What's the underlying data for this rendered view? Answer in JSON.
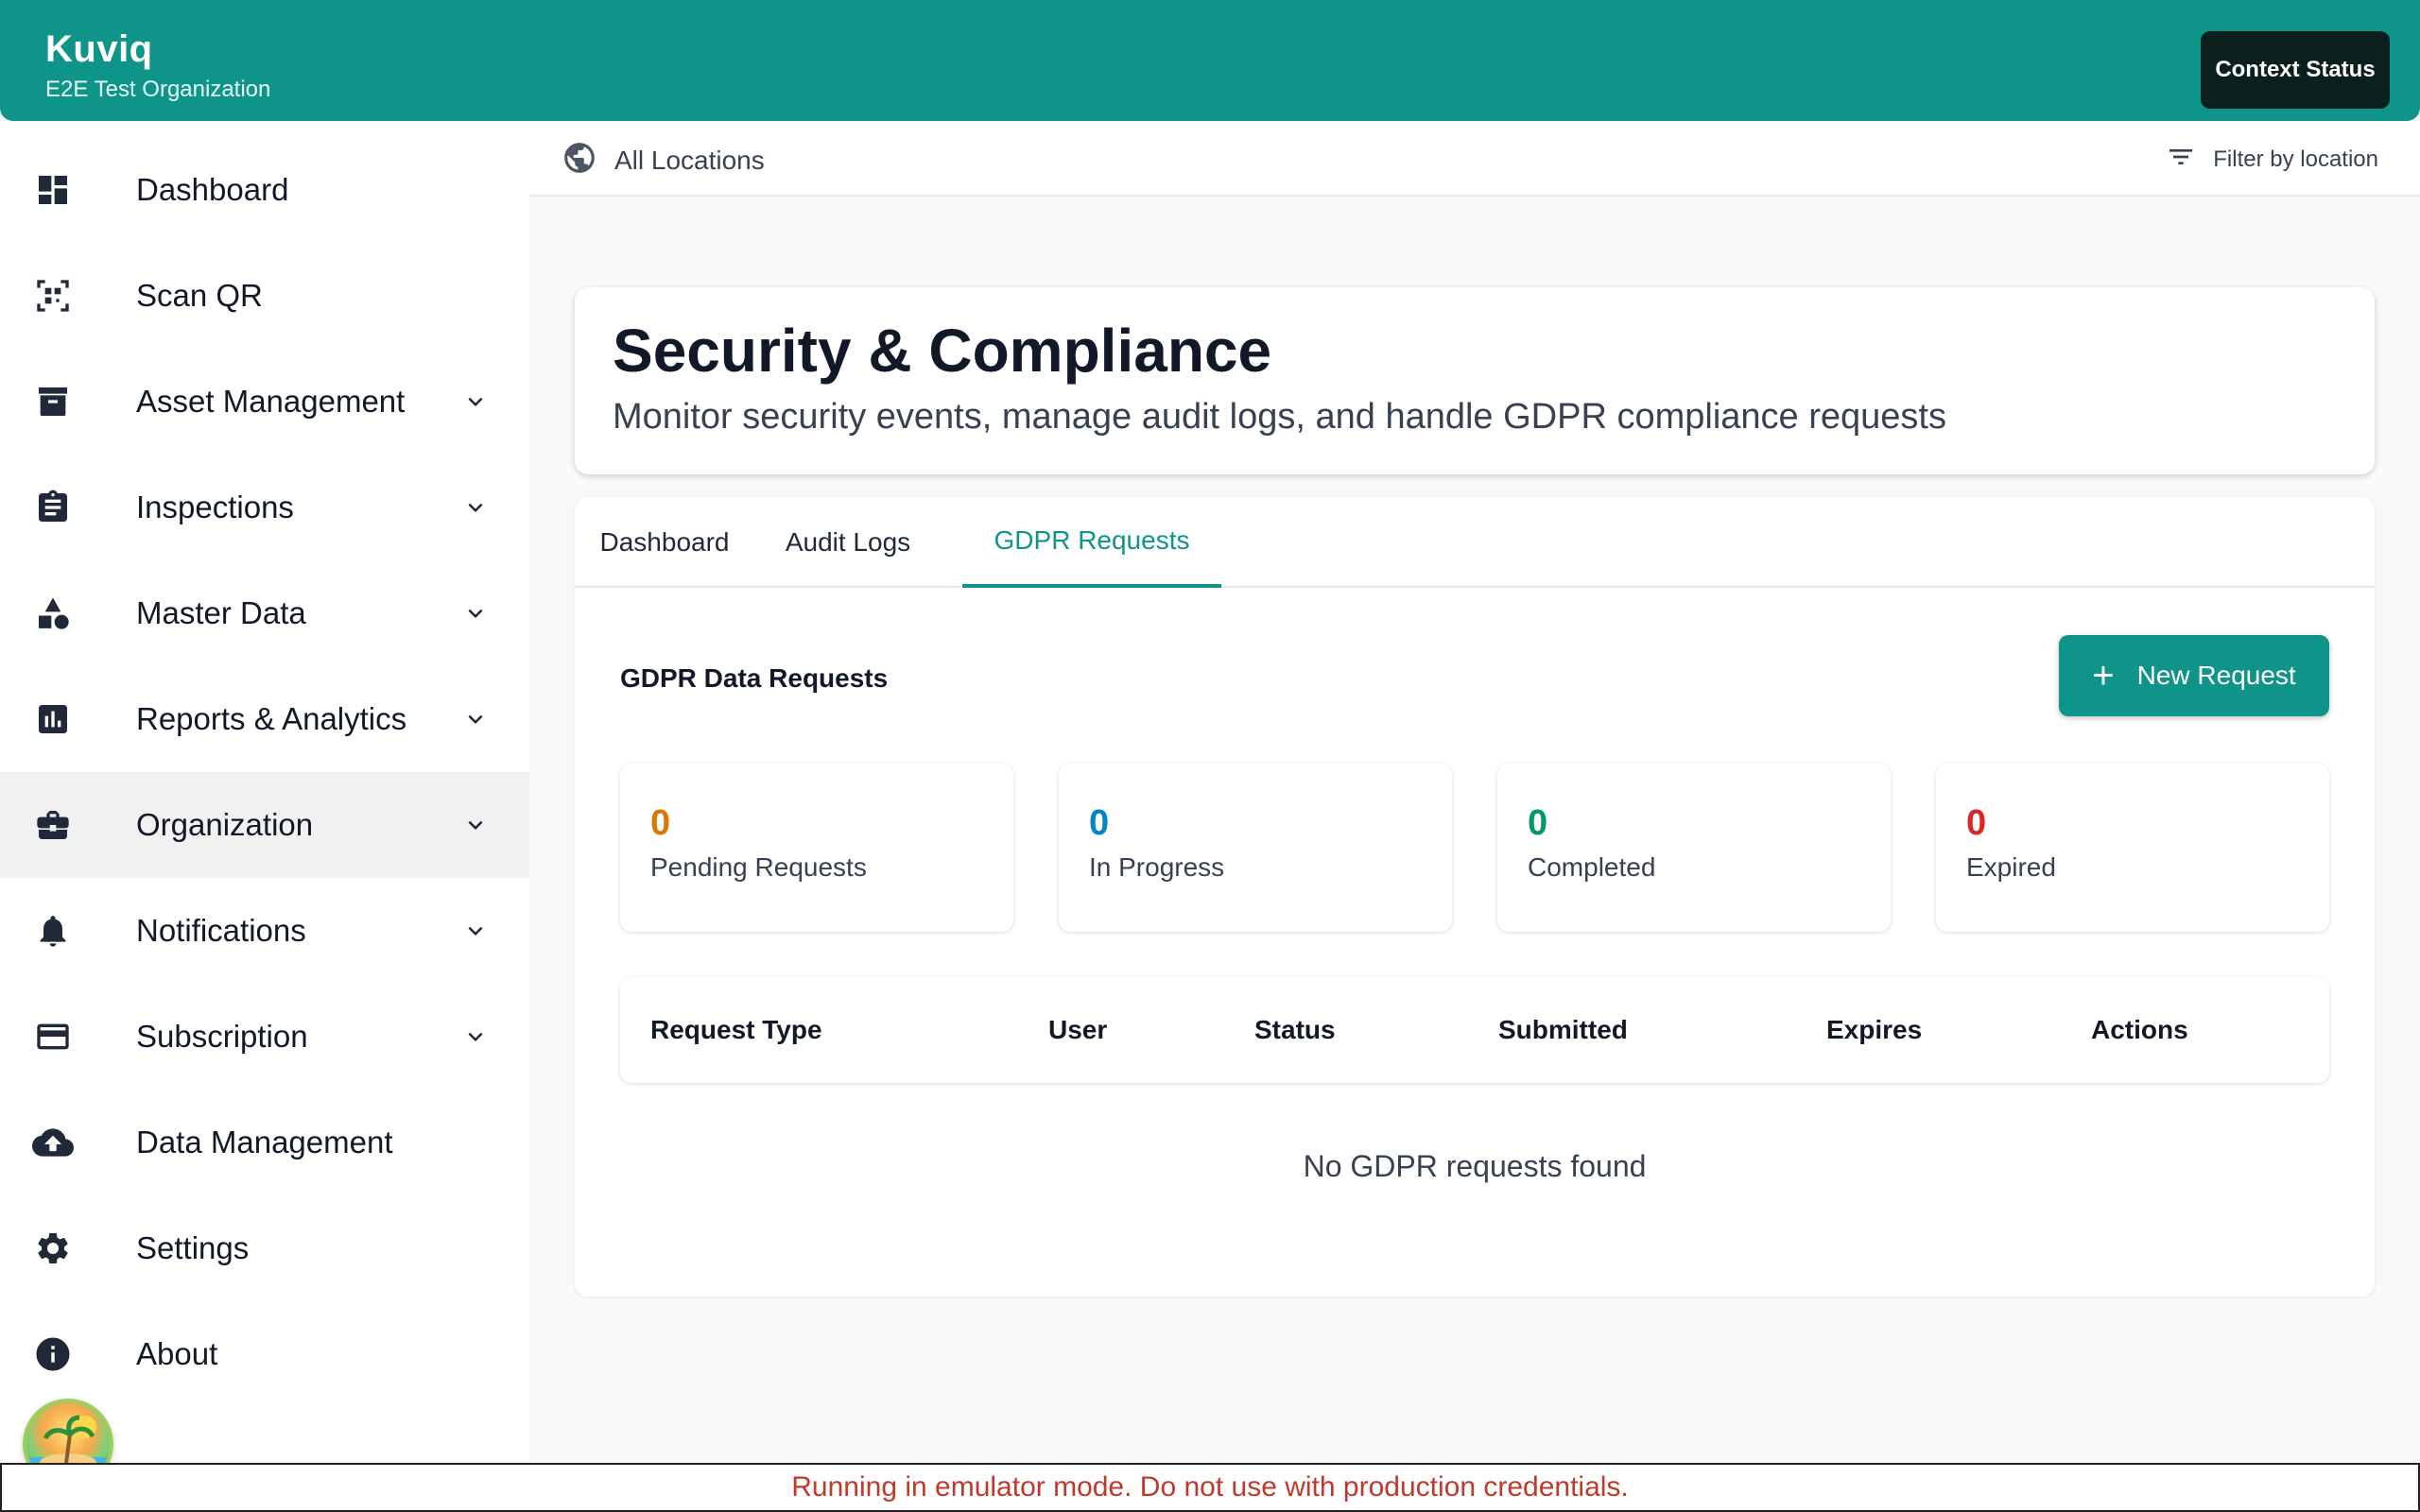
{
  "app": {
    "name": "Kuviq",
    "organization": "E2E Test Organization",
    "context_button": "Context Status"
  },
  "sidebar": {
    "items": [
      {
        "label": "Dashboard",
        "icon": "dashboard-icon",
        "expandable": false
      },
      {
        "label": "Scan QR",
        "icon": "qr-scan-icon",
        "expandable": false
      },
      {
        "label": "Asset Management",
        "icon": "archive-icon",
        "expandable": true
      },
      {
        "label": "Inspections",
        "icon": "clipboard-icon",
        "expandable": true
      },
      {
        "label": "Master Data",
        "icon": "shapes-icon",
        "expandable": true
      },
      {
        "label": "Reports & Analytics",
        "icon": "bar-chart-icon",
        "expandable": true
      },
      {
        "label": "Organization",
        "icon": "briefcase-icon",
        "expandable": true,
        "active": true
      },
      {
        "label": "Notifications",
        "icon": "bell-icon",
        "expandable": true
      },
      {
        "label": "Subscription",
        "icon": "credit-card-icon",
        "expandable": true
      },
      {
        "label": "Data Management",
        "icon": "cloud-upload-icon",
        "expandable": false
      },
      {
        "label": "Settings",
        "icon": "gear-icon",
        "expandable": false
      },
      {
        "label": "About",
        "icon": "info-icon",
        "expandable": false
      }
    ]
  },
  "location_bar": {
    "current": "All Locations",
    "filter_label": "Filter by location"
  },
  "header": {
    "title": "Security & Compliance",
    "subtitle": "Monitor security events, manage audit logs, and handle GDPR compliance requests"
  },
  "tabs": [
    {
      "label": "Dashboard",
      "active": false
    },
    {
      "label": "Audit Logs",
      "active": false
    },
    {
      "label": "GDPR Requests",
      "active": true
    }
  ],
  "gdpr": {
    "section_title": "GDPR Data Requests",
    "new_button": "New Request",
    "stats": [
      {
        "value": "0",
        "label": "Pending Requests",
        "color": "#d97706"
      },
      {
        "value": "0",
        "label": "In Progress",
        "color": "#0284c7"
      },
      {
        "value": "0",
        "label": "Completed",
        "color": "#059669"
      },
      {
        "value": "0",
        "label": "Expired",
        "color": "#dc2626"
      }
    ],
    "columns": [
      "Request Type",
      "User",
      "Status",
      "Submitted",
      "Expires",
      "Actions"
    ],
    "empty_message": "No GDPR requests found"
  },
  "banner": {
    "text": "Running in emulator mode. Do not use with production credentials."
  },
  "colors": {
    "primary": "#0e9488",
    "banner_text": "#c0392b"
  }
}
